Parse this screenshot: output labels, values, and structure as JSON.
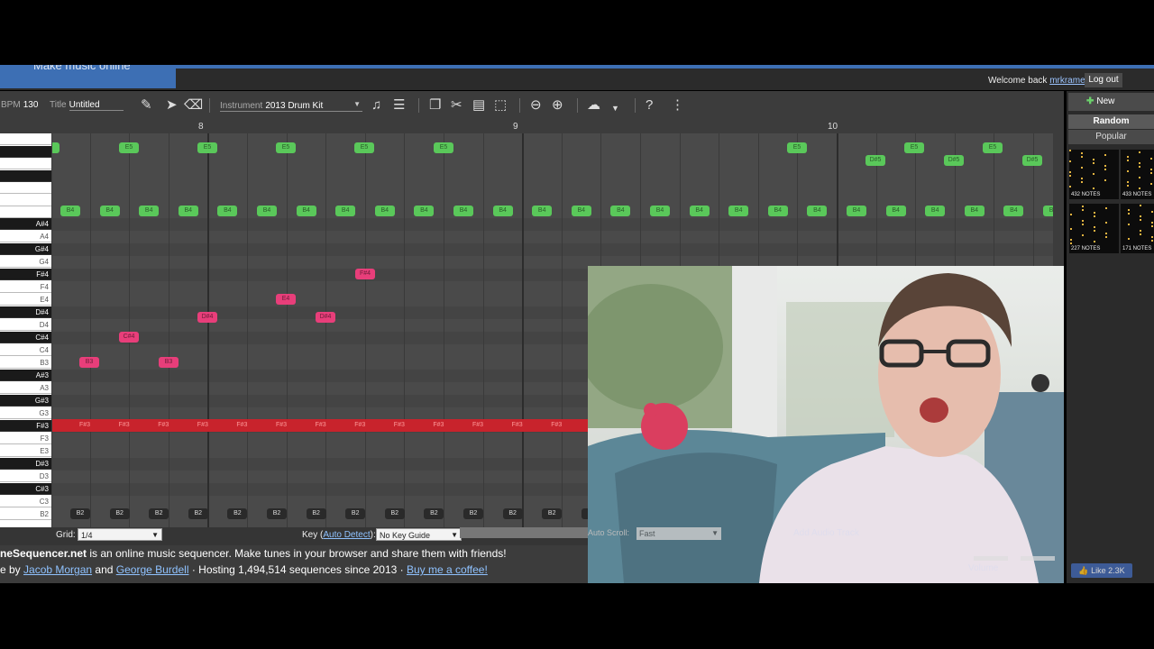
{
  "site": {
    "tagline": "Make music online",
    "welcome_prefix": "Welcome back",
    "username": "mrkramer",
    "welcome_suffix": "!",
    "logout": "Log out"
  },
  "toolbar": {
    "bpm_label": "BPM",
    "bpm_value": "130",
    "title_label": "Title",
    "title_value": "Untitled",
    "instrument_label": "Instrument",
    "instrument_value": "2013 Drum Kit",
    "icons": [
      "edit-icon",
      "pointer-icon",
      "eraser-icon",
      "note-settings-icon",
      "sliders-icon",
      "copy-icon",
      "cut-icon",
      "paste-icon",
      "select-icon",
      "zoom-out-icon",
      "zoom-in-icon",
      "cloud-upload-icon",
      "dropdown-icon",
      "help-icon",
      "more-icon"
    ]
  },
  "ruler": {
    "markers": [
      "8",
      "9",
      "10"
    ]
  },
  "piano_keys": [
    {
      "label": "A#4",
      "black": true
    },
    {
      "label": "A4",
      "black": false
    },
    {
      "label": "G#4",
      "black": true
    },
    {
      "label": "G4",
      "black": false
    },
    {
      "label": "F#4",
      "black": true
    },
    {
      "label": "F4",
      "black": false
    },
    {
      "label": "E4",
      "black": false
    },
    {
      "label": "D#4",
      "black": true
    },
    {
      "label": "D4",
      "black": false
    },
    {
      "label": "C#4",
      "black": true
    },
    {
      "label": "C4",
      "black": false
    },
    {
      "label": "B3",
      "black": false
    },
    {
      "label": "A#3",
      "black": true
    },
    {
      "label": "A3",
      "black": false
    },
    {
      "label": "G#3",
      "black": true
    },
    {
      "label": "G3",
      "black": false
    },
    {
      "label": "F#3",
      "black": true
    },
    {
      "label": "F3",
      "black": false
    },
    {
      "label": "E3",
      "black": false
    },
    {
      "label": "D#3",
      "black": true
    },
    {
      "label": "D3",
      "black": false
    },
    {
      "label": "C#3",
      "black": true
    },
    {
      "label": "C3",
      "black": false
    },
    {
      "label": "B2",
      "black": false
    }
  ],
  "notes": {
    "e5_label": "E5",
    "ds5_label": "D#5",
    "b4_label": "B4",
    "pink": [
      {
        "label": "F#4"
      },
      {
        "label": "E4"
      },
      {
        "label": "D#4"
      },
      {
        "label": "D#4"
      },
      {
        "label": "C#4"
      },
      {
        "label": "B3"
      },
      {
        "label": "B3"
      }
    ],
    "fs3_label": "F#3",
    "b2_label": "B2"
  },
  "controls": {
    "grid_label": "Grid:",
    "grid_value": "1/4",
    "key_label": "Key",
    "key_link": "Auto Detect",
    "key_value": "No Key Guide",
    "autoscroll_label": "Auto Scroll:",
    "autoscroll_value": "Fast",
    "add_audio": "Add Audio Track",
    "volume": "Volume"
  },
  "footer": {
    "line1_bold": "neSequencer.net",
    "line1_rest": " is an online music sequencer. Make tunes in your browser and share them with friends!",
    "line2_prefix": "e by ",
    "author1": "Jacob Morgan",
    "and": " and ",
    "author2": "George Burdell",
    "hosting": " · Hosting 1,494,514 sequences since 2013 · ",
    "coffee": "Buy me a coffee!"
  },
  "sidebar": {
    "new_sequence": "New Sequence",
    "random": "Random",
    "popular": "Popular",
    "thumbs": [
      "432 NOTES",
      "433 NOTES",
      "227 NOTES",
      "171 NOTES"
    ],
    "like": "Like 2.3K"
  },
  "colors": {
    "brand": "#3d6fb4",
    "green_note": "#5ac85a",
    "pink_note": "#e83e7a",
    "red_row": "#c8232c"
  }
}
